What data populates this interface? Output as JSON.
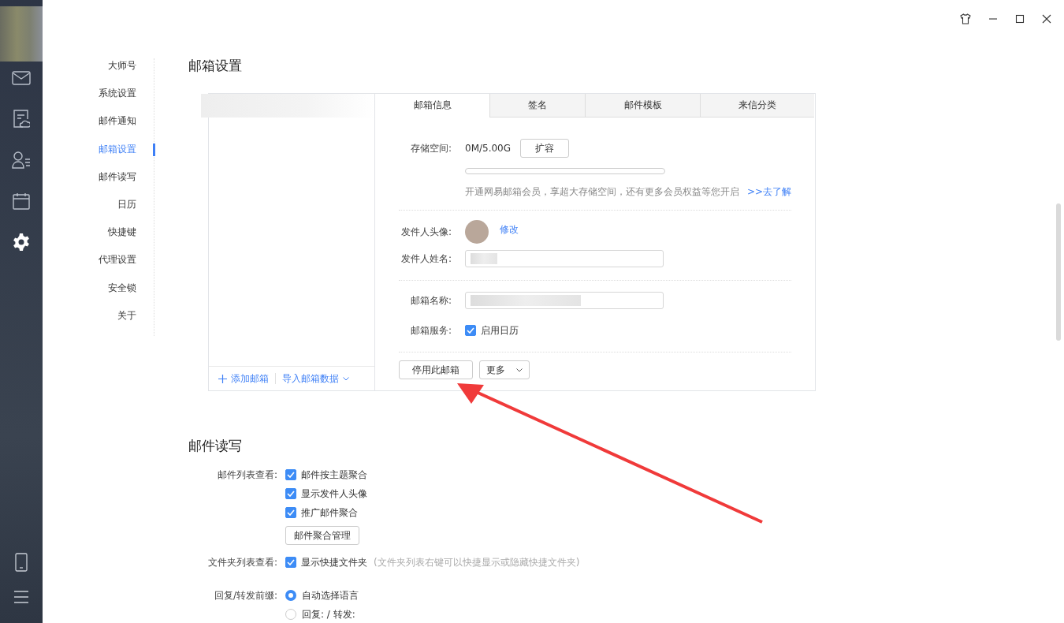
{
  "rail": {
    "items": [
      {
        "kind": "mail",
        "selected": false
      },
      {
        "kind": "cloud-note",
        "selected": false
      },
      {
        "kind": "contacts",
        "selected": false
      },
      {
        "kind": "calendar",
        "selected": false
      },
      {
        "kind": "settings",
        "selected": true
      }
    ]
  },
  "settings_nav": [
    {
      "label": "大师号",
      "selected": false
    },
    {
      "label": "系统设置",
      "selected": false
    },
    {
      "label": "邮件通知",
      "selected": false
    },
    {
      "label": "邮箱设置",
      "selected": true
    },
    {
      "label": "邮件读写",
      "selected": false
    },
    {
      "label": "日历",
      "selected": false
    },
    {
      "label": "快捷键",
      "selected": false
    },
    {
      "label": "代理设置",
      "selected": false
    },
    {
      "label": "安全锁",
      "selected": false
    },
    {
      "label": "关于",
      "selected": false
    }
  ],
  "mailbox_settings": {
    "title": "邮箱设置",
    "tabs": [
      {
        "label": "邮箱信息",
        "selected": true
      },
      {
        "label": "签名",
        "selected": false
      },
      {
        "label": "邮件模板",
        "selected": false
      },
      {
        "label": "来信分类",
        "selected": false
      }
    ],
    "add_account": "添加邮箱",
    "import_data": "导入邮箱数据",
    "storage": {
      "label": "存储空间:",
      "value": "0M/5.00G",
      "expand_button": "扩容",
      "level": 0,
      "promo": "开通网易邮箱会员，享超大存储空间，还有更多会员权益等您开启",
      "promo_link": ">>去了解"
    },
    "avatar": {
      "label": "发件人头像:",
      "edit_link": "修改"
    },
    "sender_name": {
      "label": "发件人姓名:"
    },
    "mailbox_name": {
      "label": "邮箱名称:"
    },
    "service": {
      "label": "邮箱服务:",
      "option": {
        "label": "启用日历",
        "checked": true
      }
    },
    "disable_button": "停用此邮箱",
    "more_button": "更多"
  },
  "mail_reading": {
    "title": "邮件读写",
    "list_view": {
      "label": "邮件列表查看:",
      "options": [
        {
          "label": "邮件按主题聚合",
          "checked": true
        },
        {
          "label": "显示发件人头像",
          "checked": true
        },
        {
          "label": "推广邮件聚合",
          "checked": true
        }
      ],
      "manage_button": "邮件聚合管理"
    },
    "folder_view": {
      "label": "文件夹列表查看:",
      "option": {
        "label": "显示快捷文件夹",
        "checked": true
      },
      "hint": "(文件夹列表右键可以快捷显示或隐藏快捷文件夹)"
    },
    "reply_prefix": {
      "label": "回复/转发前缀:",
      "options": [
        {
          "label": "自动选择语言",
          "selected": true
        },
        {
          "label": "回复: / 转发:",
          "selected": false
        }
      ]
    }
  }
}
